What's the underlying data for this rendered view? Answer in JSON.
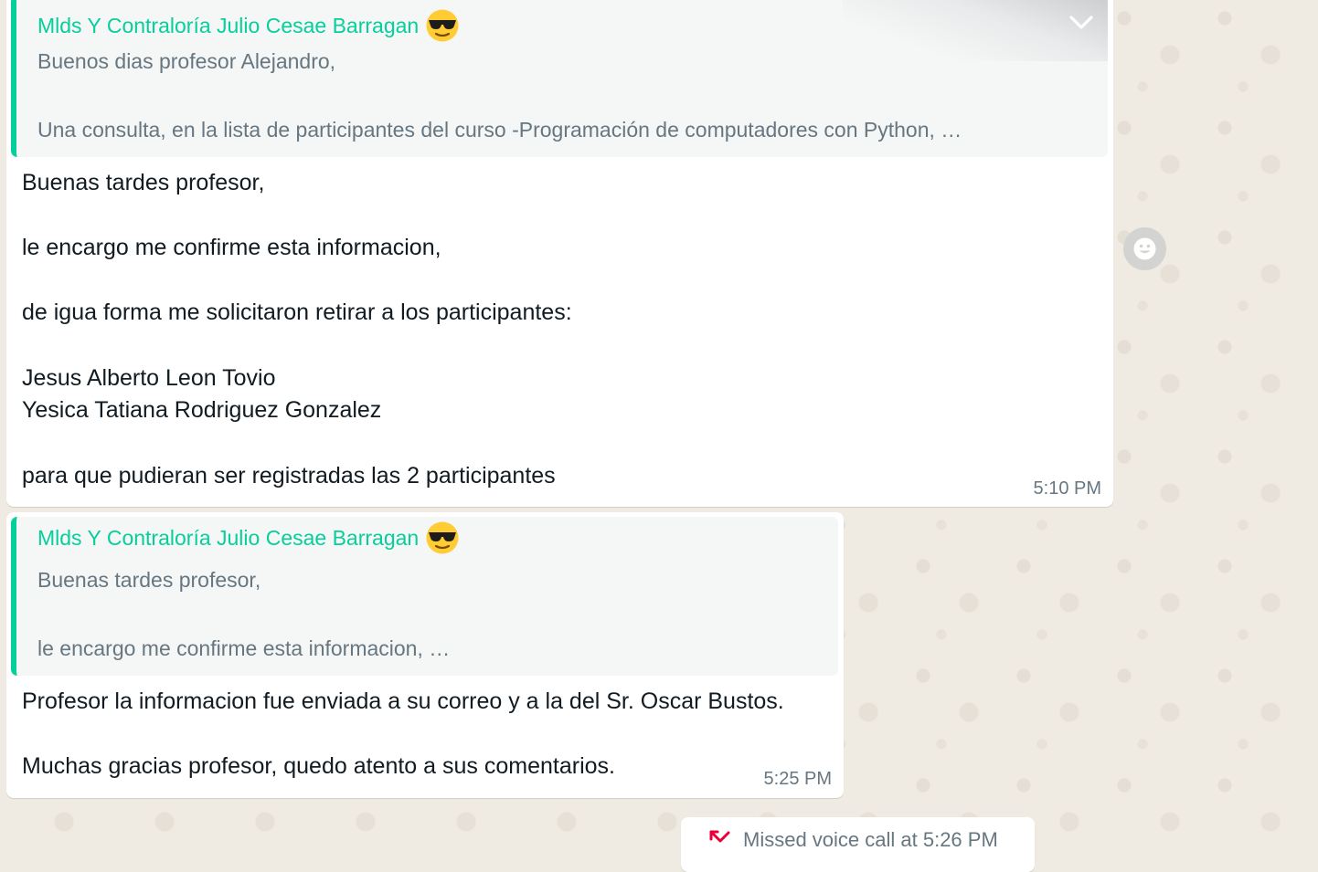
{
  "messages": [
    {
      "quote": {
        "author": "Mlds Y Contraloría Julio Cesae Barragan",
        "author_emoji": "sunglasses-emoji",
        "lines": [
          "Buenos dias profesor Alejandro,",
          "Una consulta, en la lista de participantes del curso  -Programación de computadores con Python, …"
        ]
      },
      "lines": [
        "Buenas tardes profesor,",
        "le encargo me confirme esta informacion,",
        "de igua forma me solicitaron retirar a los participantes:",
        "Jesus Alberto Leon Tovio",
        "Yesica Tatiana Rodriguez Gonzalez",
        "para que pudieran ser registradas las 2 participantes"
      ],
      "time": "5:10 PM"
    },
    {
      "quote": {
        "author": "Mlds Y Contraloría Julio Cesae Barragan",
        "author_emoji": "sunglasses-emoji",
        "lines": [
          "Buenas tardes profesor,",
          "le encargo me confirme esta informacion, …"
        ]
      },
      "lines": [
        "Profesor la informacion fue enviada a su correo y a la del Sr. Oscar Bustos.",
        "Muchas gracias profesor, quedo atento a sus comentarios."
      ],
      "time": "5:25 PM"
    }
  ],
  "system": {
    "missed_call": "Missed voice call at 5:26 PM",
    "icon": "missed-call-icon"
  },
  "icons": {
    "menu": "chevron-down-icon",
    "react": "emoji-reaction-icon"
  },
  "colors": {
    "chat_background": "#efeae2",
    "quote_accent": "#06cf9c",
    "missed_call_red": "#ea0038"
  }
}
